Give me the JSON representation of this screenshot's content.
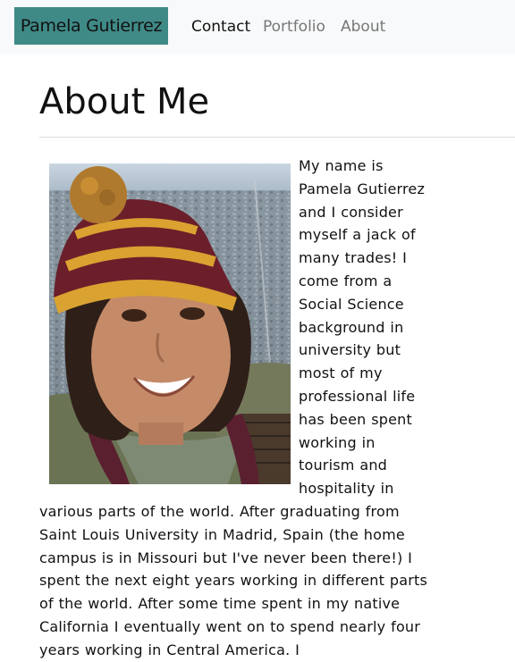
{
  "navbar": {
    "brand": "Pamela Gutierrez",
    "links": [
      {
        "label": "Contact",
        "active": true
      },
      {
        "label": "Portfolio",
        "active": false
      },
      {
        "label": "About",
        "active": false
      }
    ],
    "brand_color": "#3f8a87"
  },
  "main": {
    "title": "About Me",
    "photo": {
      "alt": "selfie-in-hot-air-balloon-photo"
    },
    "paragraph": "My name is Pamela Gutierrez and I consider myself a jack of many trades! I come from a Social Science background in university but most of my professional life has been spent working in tourism and hospitality in various parts of the world. After graduating from Saint Louis University in Madrid, Spain (the home campus is in Missouri but I've never been there!) I spent the next eight years working in different parts of the world. After some time spent in my native California I eventually went on to spend nearly four years working in Central America. I"
  }
}
